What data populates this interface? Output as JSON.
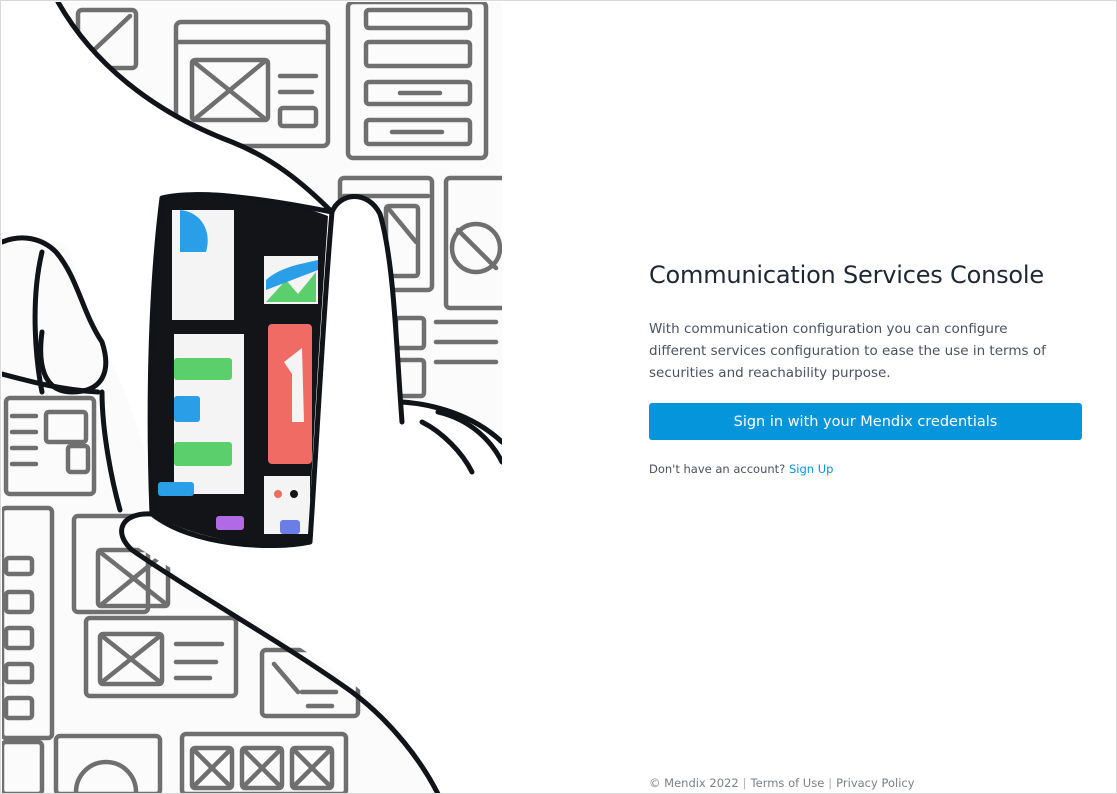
{
  "app": {
    "title": "Communication Services Console",
    "description": "With communication configuration you can configure different services configuration to ease the use in terms of securities and reachability purpose."
  },
  "signin": {
    "button_label": "Sign in with your Mendix credentials"
  },
  "signup": {
    "prompt": "Don't have an account?",
    "link_label": "Sign Up"
  },
  "footer": {
    "copyright": "© Mendix 2022",
    "separator": "|",
    "terms_label": "Terms of Use",
    "privacy_label": "Privacy Policy"
  },
  "colors": {
    "accent": "#0595db",
    "title_text": "#1f2733",
    "body_text": "#4a5260"
  },
  "illustration": {
    "description_icon": "hands-framing-app-wireframes-illustration"
  }
}
